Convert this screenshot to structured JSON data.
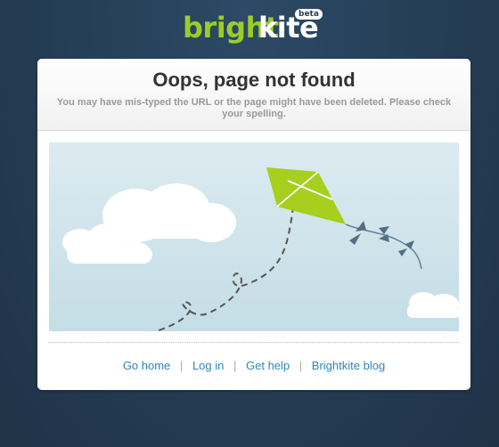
{
  "logo": {
    "bright": "bright",
    "kite": "kite",
    "badge": "beta"
  },
  "error": {
    "title": "Oops, page not found",
    "message": "You may have mis-typed the URL or the page might have been deleted. Please check your spelling."
  },
  "links": [
    {
      "label": "Go home"
    },
    {
      "label": "Log in"
    },
    {
      "label": "Get help"
    },
    {
      "label": "Brightkite blog"
    }
  ],
  "separator": "|",
  "colors": {
    "background": "#253d55",
    "brand_green": "#9ccc2a",
    "link": "#2a87b8",
    "kite": "#a6cf1e"
  }
}
